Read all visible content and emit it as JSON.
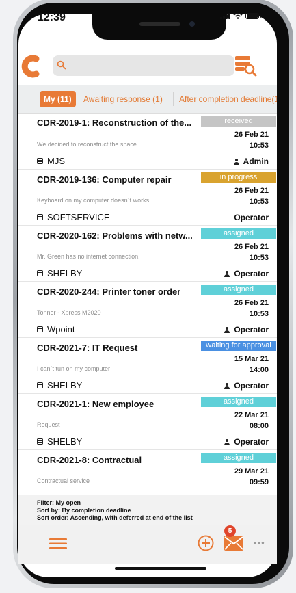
{
  "status_bar": {
    "time": "12:39"
  },
  "search": {
    "placeholder": ""
  },
  "tabs": [
    {
      "label": "My (11)"
    },
    {
      "label": "Awaiting response (1)"
    },
    {
      "label": "After completion deadline(1"
    }
  ],
  "items": [
    {
      "title": "CDR-2019-1: Reconstruction of the...",
      "status": "received",
      "status_color": "#c5c5c5",
      "date": "26 Feb 21",
      "time": "10:53",
      "desc": "We decided to reconstruct the space",
      "customer": "MJS",
      "user": "Admin",
      "user_icon": true
    },
    {
      "title": "CDR-2019-136: Computer repair",
      "status": "in progress",
      "status_color": "#d9a32f",
      "date": "26 Feb 21",
      "time": "10:53",
      "desc": "Keyboard on my computer doesn´t works.",
      "customer": "SOFTSERVICE",
      "user": "Operator",
      "user_icon": false
    },
    {
      "title": "CDR-2020-162: Problems with netw...",
      "status": "assigned",
      "status_color": "#5fd0d8",
      "date": "26 Feb 21",
      "time": "10:53",
      "desc": "Mr. Green has no internet connection.",
      "customer": "SHELBY",
      "user": "Operator",
      "user_icon": true
    },
    {
      "title": "CDR-2020-244: Printer toner order",
      "status": "assigned",
      "status_color": "#5fd0d8",
      "date": "26 Feb 21",
      "time": "10:53",
      "desc": "Tonner - Xpress M2020",
      "customer": "Wpoint",
      "user": "Operator",
      "user_icon": true
    },
    {
      "title": "CDR-2021-7: IT Request",
      "status": "waiting for approval",
      "status_color": "#4a90e2",
      "date": "15 Mar 21",
      "time": "14:00",
      "desc": "I can´t tun on my computer",
      "customer": "SHELBY",
      "user": "Operator",
      "user_icon": true
    },
    {
      "title": "CDR-2021-1: New employee",
      "status": "assigned",
      "status_color": "#5fd0d8",
      "date": "22 Mar 21",
      "time": "08:00",
      "desc": "Request",
      "customer": "SHELBY",
      "user": "Operator",
      "user_icon": true
    },
    {
      "title": "CDR-2021-8: Contractual",
      "status": "assigned",
      "status_color": "#5fd0d8",
      "date": "29 Mar 21",
      "time": "09:59",
      "desc": "Contractual service",
      "customer": "",
      "user": "",
      "user_icon": false
    }
  ],
  "footer": {
    "filter": "Filter: My open",
    "sort_by": "Sort by: By completion deadline",
    "sort_order": "Sort order: Ascending, with deferred at end of the list"
  },
  "bottom": {
    "mail_count": "5",
    "more": "•••"
  },
  "colors": {
    "accent": "#e87a36"
  }
}
